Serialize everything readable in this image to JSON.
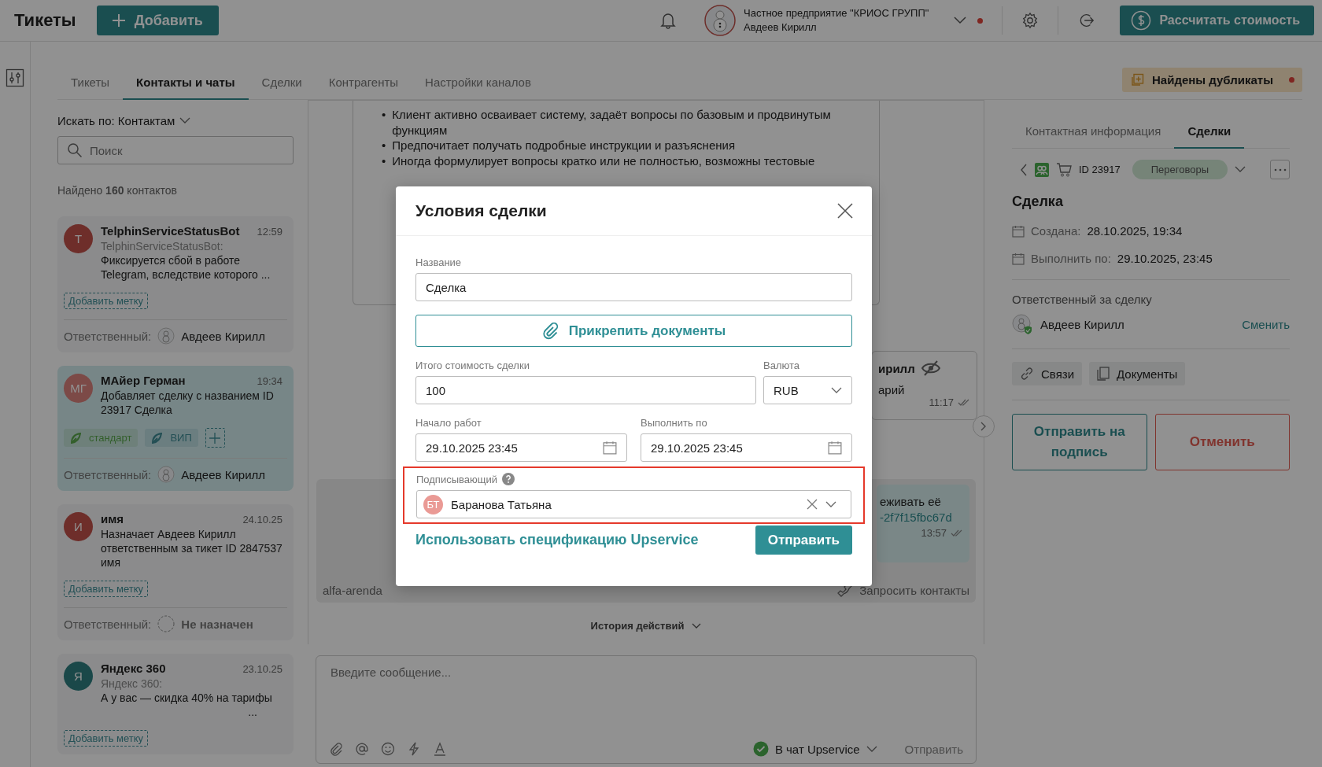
{
  "topbar": {
    "title": "Тикеты",
    "add_button": "Добавить",
    "company": "Частное предприятие \"КРИОС ГРУПП\"",
    "user": "Авдеев Кирилл",
    "calc_button": "Рассчитать стоимость"
  },
  "tabs": [
    {
      "label": "Тикеты",
      "selected": false
    },
    {
      "label": "Контакты и чаты",
      "selected": true
    },
    {
      "label": "Сделки",
      "selected": false
    },
    {
      "label": "Контрагенты",
      "selected": false
    },
    {
      "label": "Настройки каналов",
      "selected": false
    }
  ],
  "duplicates_badge": "Найдены дубликаты",
  "contacts": {
    "search_by": "Искать по: Контактам",
    "search_placeholder": "Поиск",
    "found": "Найдено **160** контактов",
    "items": [
      {
        "avatar": "Т",
        "color": "#6e2e2a",
        "name": "TelphinServiceStatusBot",
        "time": "12:59",
        "sender": "TelphinServiceStatusBot:",
        "text": "Фиксируется сбой в работе Telegram, вследствие которого ...",
        "add_tag": "Добавить метку",
        "responsible_label": "Ответственный:",
        "assignee": "Авдеев Кирилл",
        "assigned": true,
        "selected": false
      },
      {
        "avatar": "МГ",
        "color": "#7c4a47",
        "name": "МАйер Герман",
        "time": "19:34",
        "text": "Добавляет сделку с названием ID 23917 Сделка",
        "tags": [
          {
            "label": "стандарт",
            "color": "#335f2c"
          },
          {
            "label": "ВИП",
            "color": "#234f55"
          }
        ],
        "responsible_label": "Ответственный:",
        "assignee": "Авдеев Кирилл",
        "assigned": true,
        "selected": true
      },
      {
        "avatar": "И",
        "color": "#6e2e2a",
        "name": "имя",
        "time": "24.10.25",
        "text": "Назначает Авдеев Кирилл ответственным за тикет ID 2847537 имя",
        "add_tag": "Добавить метку",
        "responsible_label": "Ответственный:",
        "assignee": "Не назначен",
        "assigned": false,
        "selected": false
      },
      {
        "avatar": "Я",
        "color": "#1a4849",
        "name": "Яндекс 360",
        "time": "23.10.25",
        "sender": "Яндекс 360:",
        "text": "А у вас — скидка 40% на тарифы",
        "more": "...",
        "add_tag": "Добавить метку",
        "selected": false
      }
    ]
  },
  "chat": {
    "bullets": [
      {
        "marker": "•",
        "text": "Клиент активно осваивает систему, задаёт вопросы по базовым и продвинутым функциям"
      },
      {
        "marker": "•",
        "text": "Предпочитает получать подробные инструкции и разъяснения"
      },
      {
        "marker": "•",
        "text": "Иногда формулирует вопросы кратко или не полностью, возможны тестовые"
      }
    ],
    "message_1": {
      "author": "ирилл",
      "text": "арий",
      "time": "11:17"
    },
    "message_2": {
      "text": "еживать её",
      "link": "-2f7f15fbc67d",
      "time": "13:57"
    },
    "channel_name": "alfa-arenda",
    "request_contacts": "Запросить контакты",
    "history": "История действий",
    "input_placeholder": "Введите сообщение...",
    "target": "В чат Upservice",
    "send": "Отправить"
  },
  "deal_panel": {
    "tabs": [
      {
        "label": "Контактная информация",
        "selected": false
      },
      {
        "label": "Сделки",
        "selected": true
      }
    ],
    "id": "ID 23917",
    "status": "Переговоры",
    "title": "Сделка",
    "created_label": "Создана:",
    "created": "28.10.2025, 19:34",
    "due_label": "Выполнить по:",
    "due": "29.10.2025, 23:45",
    "responsible_label": "Ответственный за сделку",
    "responsible": "Авдеев Кирилл",
    "change": "Сменить",
    "links": "Связи",
    "documents": "Документы",
    "sign_button": "Отправить на подпись",
    "cancel_button": "Отменить"
  },
  "modal": {
    "title": "Условия сделки",
    "name_label": "Название",
    "name": "Сделка",
    "attach": "Прикрепить документы",
    "total_label": "Итого стоимость сделки",
    "total": "100",
    "currency_label": "Валюта",
    "currency": "RUB",
    "start_label": "Начало работ",
    "start": "29.10.2025 23:45",
    "due_label": "Выполнить по",
    "due": "29.10.2025 23:45",
    "signer_label": "Подписывающий",
    "signer_avatar": "БТ",
    "signer": "Баранова Татьяна",
    "signer_highlighted": true,
    "spec_link": "Использовать спецификацию Upservice",
    "submit": "Отправить"
  }
}
